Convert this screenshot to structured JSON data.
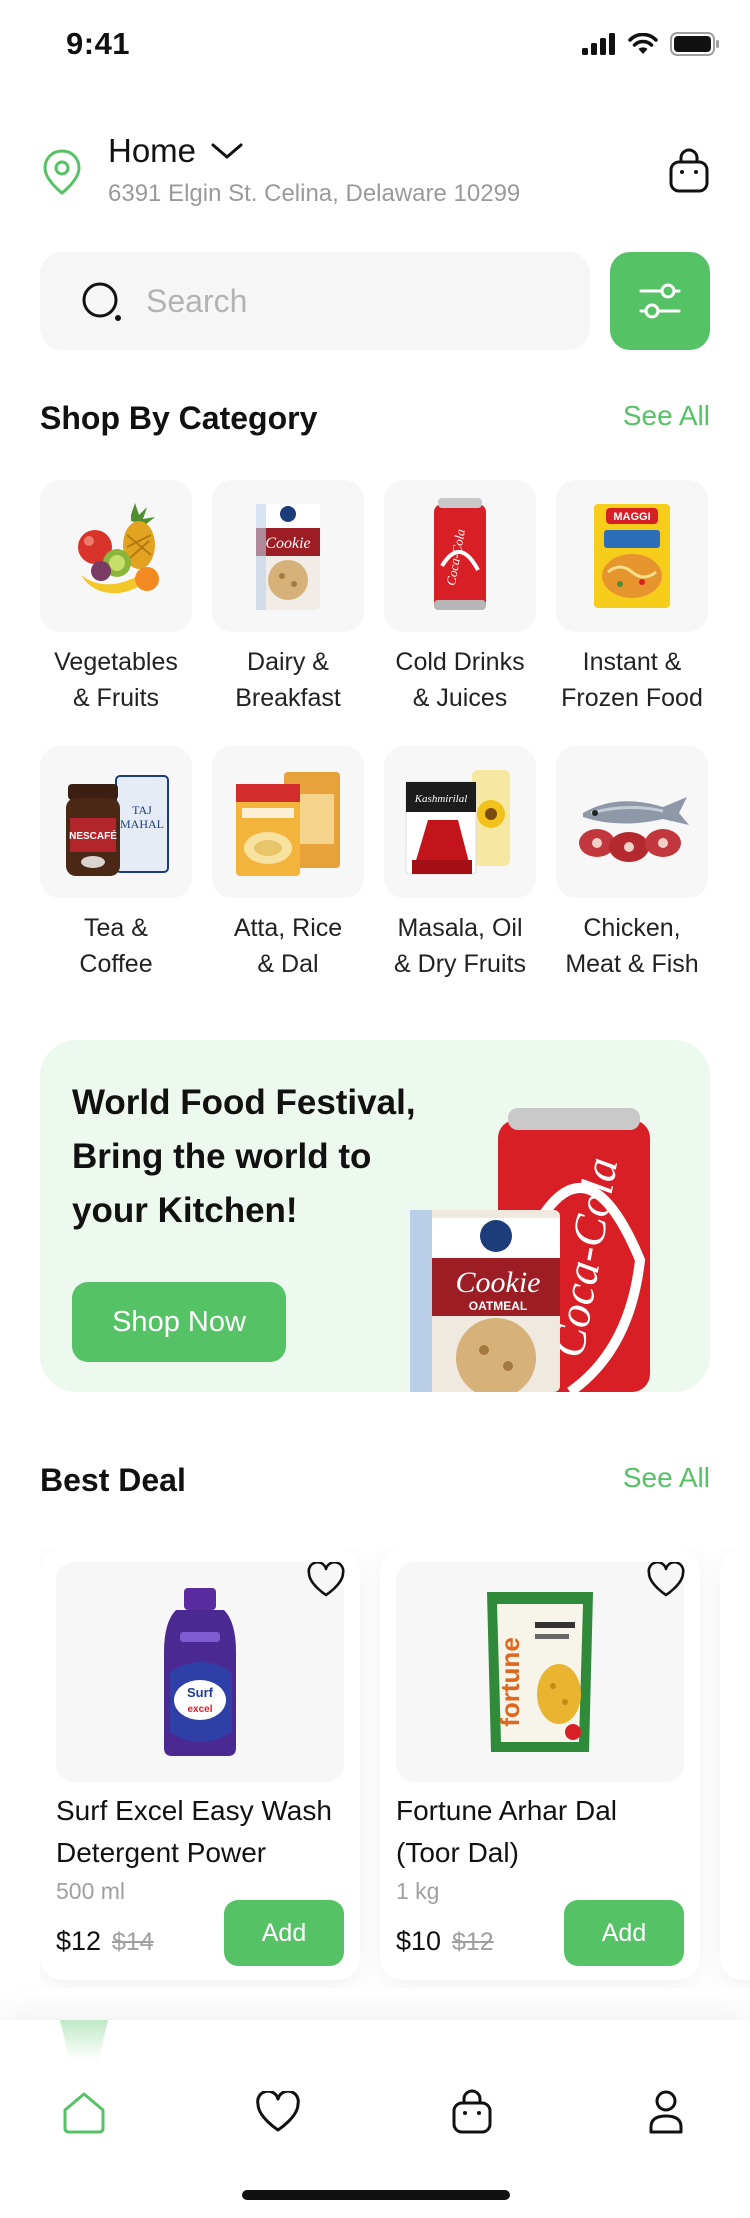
{
  "status_bar": {
    "time": "9:41"
  },
  "location": {
    "title": "Home",
    "address": "6391 Elgin St. Celina, Delaware 10299"
  },
  "search": {
    "placeholder": "Search"
  },
  "categories_section": {
    "title": "Shop By Category",
    "see_all": "See All",
    "items": [
      {
        "line1": "Vegetables",
        "line2": "& Fruits",
        "icon": "fruits-basket-icon"
      },
      {
        "line1": "Dairy &",
        "line2": "Breakfast",
        "icon": "oatmeal-pack-icon"
      },
      {
        "line1": "Cold Drinks",
        "line2": "& Juices",
        "icon": "soda-can-icon"
      },
      {
        "line1": "Instant &",
        "line2": "Frozen Food",
        "icon": "noodles-pack-icon"
      },
      {
        "line1": "Tea &",
        "line2": "Coffee",
        "icon": "coffee-jar-icon"
      },
      {
        "line1": "Atta, Rice",
        "line2": "& Dal",
        "icon": "grain-bags-icon"
      },
      {
        "line1": "Masala, Oil",
        "line2": "& Dry Fruits",
        "icon": "spice-oil-icon"
      },
      {
        "line1": "Chicken,",
        "line2": "Meat & Fish",
        "icon": "meat-fish-icon"
      }
    ]
  },
  "banner": {
    "line1": "World Food Festival,",
    "line2": "Bring the world to",
    "line3": "your Kitchen!",
    "cta": "Shop Now"
  },
  "deals_section": {
    "title": "Best Deal",
    "see_all": "See All",
    "items": [
      {
        "name_line1": "Surf Excel Easy Wash",
        "name_line2": "Detergent Power",
        "size": "500 ml",
        "price": "$12",
        "old_price": "$14",
        "add": "Add"
      },
      {
        "name_line1": "Fortune Arhar Dal",
        "name_line2": "(Toor Dal)",
        "size": "1 kg",
        "price": "$10",
        "old_price": "$12",
        "add": "Add"
      }
    ]
  },
  "colors": {
    "accent": "#56c266",
    "banner_bg": "#edf8ee",
    "muted": "#9a9a9a"
  },
  "bottom_nav": [
    "home-icon",
    "heart-icon",
    "bag-icon",
    "profile-icon"
  ]
}
